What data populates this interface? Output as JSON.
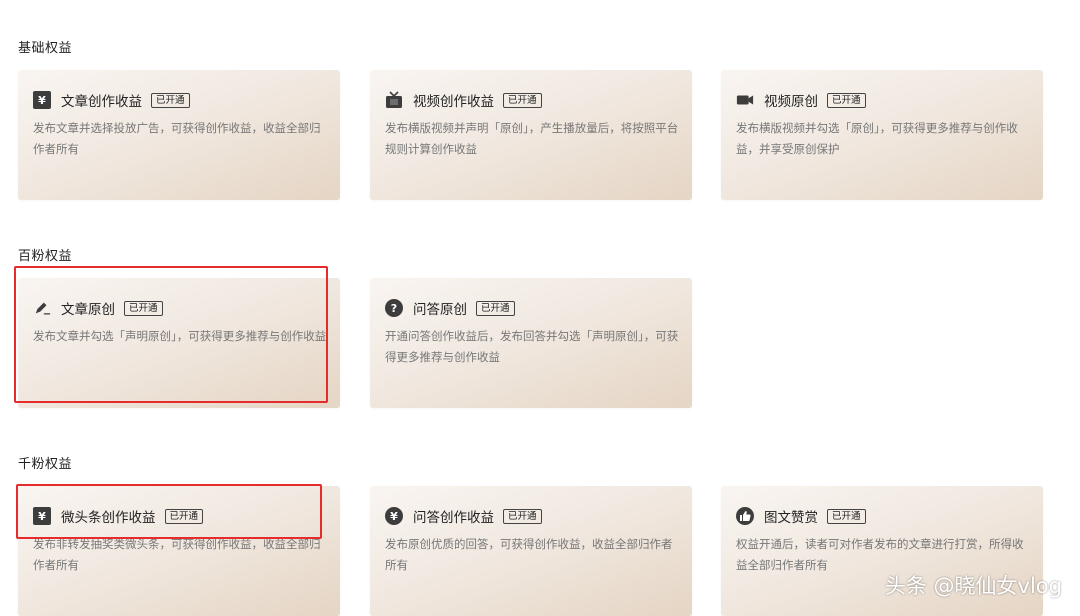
{
  "sections": [
    {
      "title": "基础权益",
      "cards": [
        {
          "icon": "yen-square-icon",
          "icon_text": "¥",
          "title": "文章创作收益",
          "badge": "已开通",
          "desc": "发布文章并选择投放广告，可获得创作收益，收益全部归作者所有"
        },
        {
          "icon": "tv-icon",
          "icon_text": "",
          "title": "视频创作收益",
          "badge": "已开通",
          "desc": "发布横版视频并声明「原创」，产生播放量后，将按照平台规则计算创作收益"
        },
        {
          "icon": "video-camera-icon",
          "icon_text": "",
          "title": "视频原创",
          "badge": "已开通",
          "desc": "发布横版视频并勾选「原创」，可获得更多推荐与创作收益，并享受原创保护"
        }
      ]
    },
    {
      "title": "百粉权益",
      "cards": [
        {
          "icon": "pen-icon",
          "icon_text": "",
          "title": "文章原创",
          "badge": "已开通",
          "desc": "发布文章并勾选「声明原创」，可获得更多推荐与创作收益"
        },
        {
          "icon": "question-circle-icon",
          "icon_text": "?",
          "title": "问答原创",
          "badge": "已开通",
          "desc": "开通问答创作收益后，发布回答并勾选「声明原创」，可获得更多推荐与创作收益"
        }
      ]
    },
    {
      "title": "千粉权益",
      "cards": [
        {
          "icon": "yen-square-icon",
          "icon_text": "¥",
          "title": "微头条创作收益",
          "badge": "已开通",
          "desc": "发布非转发抽奖类微头条，可获得创作收益，收益全部归作者所有"
        },
        {
          "icon": "yen-circle-icon",
          "icon_text": "¥",
          "title": "问答创作收益",
          "badge": "已开通",
          "desc": "发布原创优质的回答，可获得创作收益，收益全部归作者所有"
        },
        {
          "icon": "thumbs-up-icon",
          "icon_text": "",
          "title": "图文赞赏",
          "badge": "已开通",
          "desc": "权益开通后，读者可对作者发布的文章进行打赏，所得收益全部归作者所有"
        }
      ]
    }
  ],
  "watermark": "头条 @晓仙女vlog",
  "colors": {
    "highlight": "#e52b2b",
    "card_gradient_start": "#f9f5f1",
    "card_gradient_end": "#e5d5c4",
    "icon_dark": "#3d3d3d"
  }
}
